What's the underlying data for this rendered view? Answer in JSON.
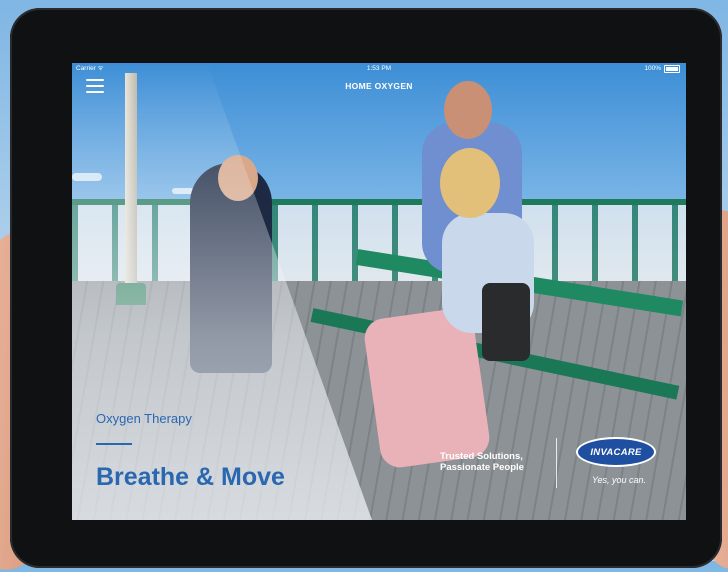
{
  "status": {
    "carrier": "Carrier ᯤ",
    "time": "1:53 PM",
    "battery": "100%"
  },
  "nav": {
    "title": "HOME OXYGEN"
  },
  "hero": {
    "subtitle": "Oxygen Therapy",
    "headline": "Breathe & Move",
    "tagline_line1": "Trusted Solutions,",
    "tagline_line2": "Passionate People"
  },
  "brand": {
    "logo_text": "INVACARE",
    "slogan": "Yes, you can.",
    "accent_color": "#2a67b1",
    "logo_color": "#1f4fa1"
  },
  "icons": {
    "menu": "hamburger-menu-icon",
    "wifi": "wifi-icon",
    "battery": "battery-icon"
  }
}
